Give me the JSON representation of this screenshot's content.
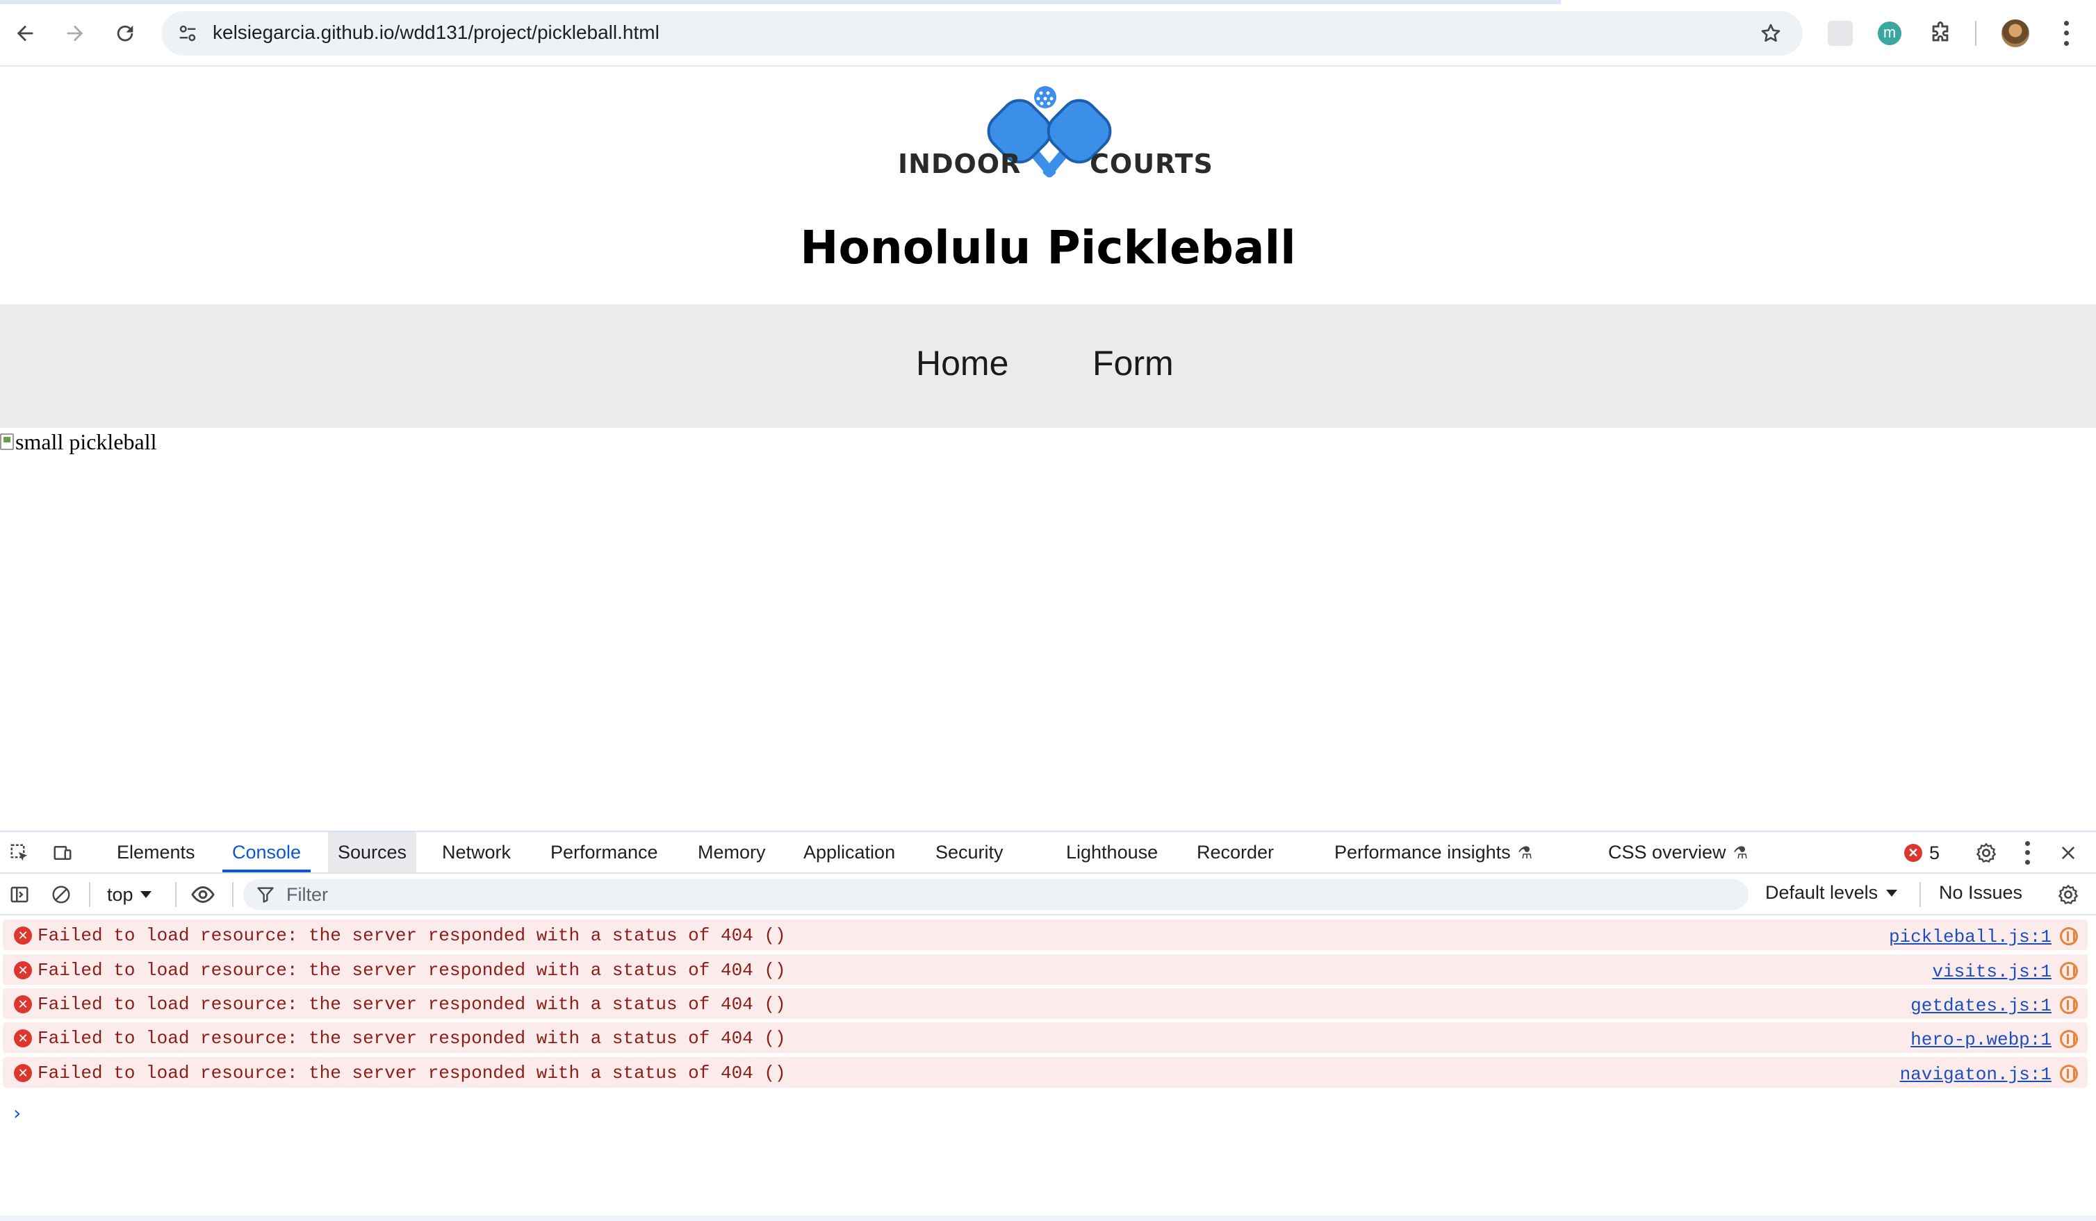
{
  "browser": {
    "url": "kelsiegarcia.github.io/wdd131/project/pickleball.html",
    "extension_badge": "m"
  },
  "page": {
    "logo_left": "INDOOR",
    "logo_right": "COURTS",
    "title": "Honolulu Pickleball",
    "nav": [
      "Home",
      "Form"
    ],
    "broken_image_alt": "small pickleball",
    "colors": {
      "brand": "#3b8fe8",
      "nav_bg": "#e9ecea"
    }
  },
  "devtools": {
    "tabs": [
      "Elements",
      "Console",
      "Sources",
      "Network",
      "Performance",
      "Memory",
      "Application",
      "Security",
      "Lighthouse",
      "Recorder",
      "Performance insights",
      "CSS overview"
    ],
    "active_tab": "Console",
    "error_count": "5",
    "context": "top",
    "filter_placeholder": "Filter",
    "levels": "Default levels",
    "issues": "No Issues",
    "messages": [
      {
        "text": "Failed to load resource: the server responded with a status of 404 ()",
        "source": "pickleball.js:1"
      },
      {
        "text": "Failed to load resource: the server responded with a status of 404 ()",
        "source": "visits.js:1"
      },
      {
        "text": "Failed to load resource: the server responded with a status of 404 ()",
        "source": "getdates.js:1"
      },
      {
        "text": "Failed to load resource: the server responded with a status of 404 ()",
        "source": "hero-p.webp:1"
      },
      {
        "text": "Failed to load resource: the server responded with a status of 404 ()",
        "source": "navigaton.js:1"
      }
    ],
    "prompt_symbol": "›"
  }
}
